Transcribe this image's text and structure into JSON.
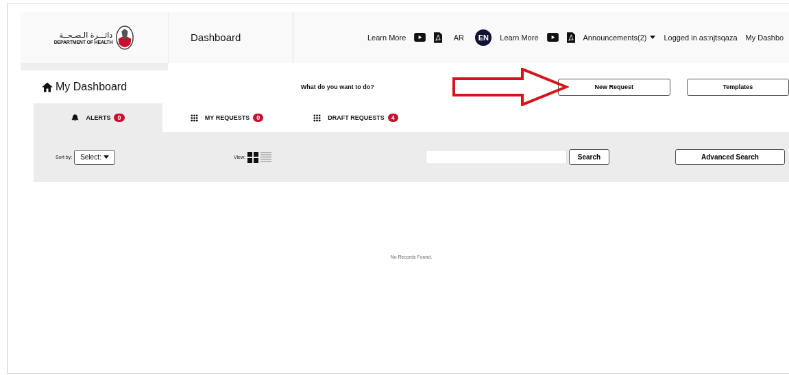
{
  "header": {
    "logo": {
      "arabic": "دائـــرة الـصـحــة",
      "english": "DEPARTMENT OF HEALTH"
    },
    "title": "Dashboard",
    "nav": [
      {
        "kind": "link",
        "label": "Learn More"
      },
      {
        "kind": "video"
      },
      {
        "kind": "pdf"
      },
      {
        "kind": "lang",
        "label": "AR",
        "selected": false
      },
      {
        "kind": "lang",
        "label": "EN",
        "selected": true
      },
      {
        "kind": "link",
        "label": "Learn More"
      },
      {
        "kind": "video"
      },
      {
        "kind": "pdf"
      },
      {
        "kind": "dropdown",
        "label": "Announcements(2)"
      },
      {
        "kind": "text",
        "label": "Logged in as:njtsqaza"
      },
      {
        "kind": "link",
        "label": "My Dashbo"
      }
    ]
  },
  "page": {
    "title": "My Dashboard",
    "prompt": "What do you want to do?",
    "actions": [
      "New Request",
      "Templates"
    ]
  },
  "tabs": [
    {
      "label": "ALERTS",
      "count": "0",
      "kind": "alerts",
      "selected": true
    },
    {
      "label": "MY REQUESTS",
      "count": "0",
      "kind": "requests",
      "selected": false
    },
    {
      "label": "DRAFT REQUESTS",
      "count": "4",
      "kind": "requests",
      "selected": false
    }
  ],
  "filters": {
    "sort_label": "Sort by:",
    "sort_value": "Select:",
    "view_label": "View:",
    "views": [
      {
        "kind": "grid",
        "selected": true
      },
      {
        "kind": "list",
        "selected": false
      }
    ],
    "search_button": "Search",
    "advanced_button": "Advanced Search"
  },
  "empty_message": "No Records Found."
}
